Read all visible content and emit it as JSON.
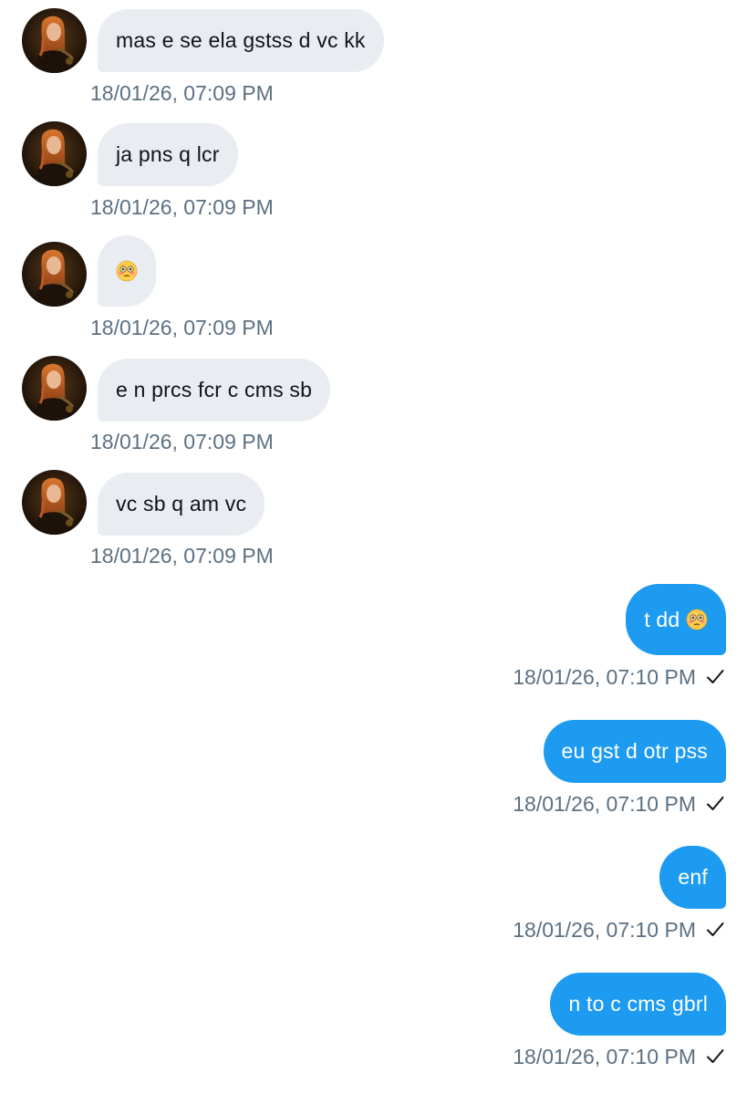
{
  "conversation": {
    "incoming": [
      {
        "text": "mas e se ela gstss d vc kk",
        "time": "18/01/26, 07:09 PM"
      },
      {
        "text": "ja pns q lcr",
        "time": "18/01/26, 07:09 PM"
      },
      {
        "text": "",
        "emoji": "flushed-face-emoji",
        "time": "18/01/26, 07:09 PM"
      },
      {
        "text": "e n prcs fcr c cms sb",
        "time": "18/01/26, 07:09 PM"
      },
      {
        "text": "vc sb q am vc",
        "time": "18/01/26, 07:09 PM"
      }
    ],
    "outgoing": [
      {
        "text": "t dd",
        "emoji": "flushed-face-emoji",
        "time": "18/01/26, 07:10 PM",
        "status_icon": "check-icon"
      },
      {
        "text": "eu gst d otr pss",
        "time": "18/01/26, 07:10 PM",
        "status_icon": "check-icon"
      },
      {
        "text": "enf",
        "time": "18/01/26, 07:10 PM",
        "status_icon": "check-icon"
      },
      {
        "text": "n to c cms gbrl",
        "time": "18/01/26, 07:10 PM",
        "status_icon": "check-icon"
      }
    ]
  },
  "colors": {
    "incoming_bubble": "#e9edf1",
    "outgoing_bubble": "#1d9bf0",
    "timestamp": "#5b7083",
    "text_dark": "#0f1419"
  }
}
